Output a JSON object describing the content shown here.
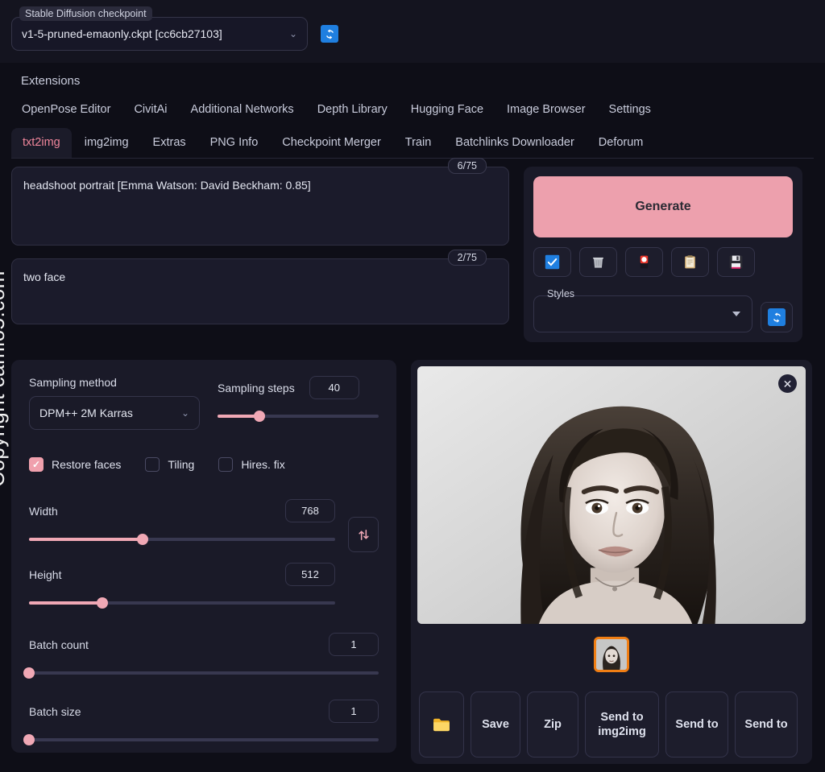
{
  "checkpoint": {
    "legend": "Stable Diffusion checkpoint",
    "value": "v1-5-pruned-emaonly.ckpt [cc6cb27103]",
    "caret": "⌄",
    "refresh_icon": "refresh-icon"
  },
  "nav": {
    "extensions_label": "Extensions",
    "items": [
      {
        "label": "OpenPose Editor"
      },
      {
        "label": "CivitAi"
      },
      {
        "label": "Additional Networks"
      },
      {
        "label": "Depth Library"
      },
      {
        "label": "Hugging Face"
      },
      {
        "label": "Image Browser"
      },
      {
        "label": "Settings"
      }
    ],
    "tabs": [
      {
        "label": "txt2img",
        "active": true
      },
      {
        "label": "img2img",
        "active": false
      },
      {
        "label": "Extras",
        "active": false
      },
      {
        "label": "PNG Info",
        "active": false
      },
      {
        "label": "Checkpoint Merger",
        "active": false
      },
      {
        "label": "Train",
        "active": false
      },
      {
        "label": "Batchlinks Downloader",
        "active": false
      },
      {
        "label": "Deforum",
        "active": false
      }
    ]
  },
  "prompt": {
    "positive_value": "headshoot portrait [Emma Watson: David Beckham: 0.85]",
    "positive_counter": "6/75",
    "negative_value": "two face",
    "negative_counter": "2/75"
  },
  "generate": {
    "label": "Generate",
    "icons": [
      {
        "name": "checkbox-blue-icon"
      },
      {
        "name": "trash-icon"
      },
      {
        "name": "paintbrush-icon"
      },
      {
        "name": "clipboard-icon"
      },
      {
        "name": "floppy-disk-icon"
      }
    ]
  },
  "styles": {
    "legend": "Styles",
    "value": "",
    "refresh_icon": "refresh-icon"
  },
  "settings": {
    "sampling_method_label": "Sampling method",
    "sampling_method_value": "DPM++ 2M Karras",
    "sampling_steps_label": "Sampling steps",
    "sampling_steps_value": "40",
    "sampling_steps_percent": 26,
    "checkboxes": [
      {
        "label": "Restore faces",
        "checked": true
      },
      {
        "label": "Tiling",
        "checked": false
      },
      {
        "label": "Hires. fix",
        "checked": false
      }
    ],
    "width_label": "Width",
    "width_value": "768",
    "width_percent": 37,
    "height_label": "Height",
    "height_value": "512",
    "height_percent": 24,
    "swap_icon": "swap-vertical-icon",
    "batch_count_label": "Batch count",
    "batch_count_value": "1",
    "batch_count_percent": 0,
    "batch_size_label": "Batch size",
    "batch_size_value": "1",
    "batch_size_percent": 0
  },
  "output": {
    "close_icon": "close-icon",
    "close_glyph": "✕",
    "thumbnail_name": "result-thumbnail",
    "buttons": [
      {
        "name": "open-folder-button",
        "label": "📁"
      },
      {
        "name": "save-button",
        "label": "Save"
      },
      {
        "name": "zip-button",
        "label": "Zip"
      },
      {
        "name": "send-to-img2img-button",
        "label": "Send to img2img"
      },
      {
        "name": "send-to-inpaint-button",
        "label": "Send to"
      },
      {
        "name": "send-to-extras-button",
        "label": "Send to"
      }
    ]
  },
  "watermark": {
    "text": "Copyright camlo5.com"
  },
  "colors": {
    "accent_pink": "#eda0ad",
    "accent_blue": "#1f7fe0",
    "tab_active": "#f0869b",
    "thumb_border": "#f07e14",
    "background": "#0e0e17",
    "panel": "#1a1a28"
  }
}
